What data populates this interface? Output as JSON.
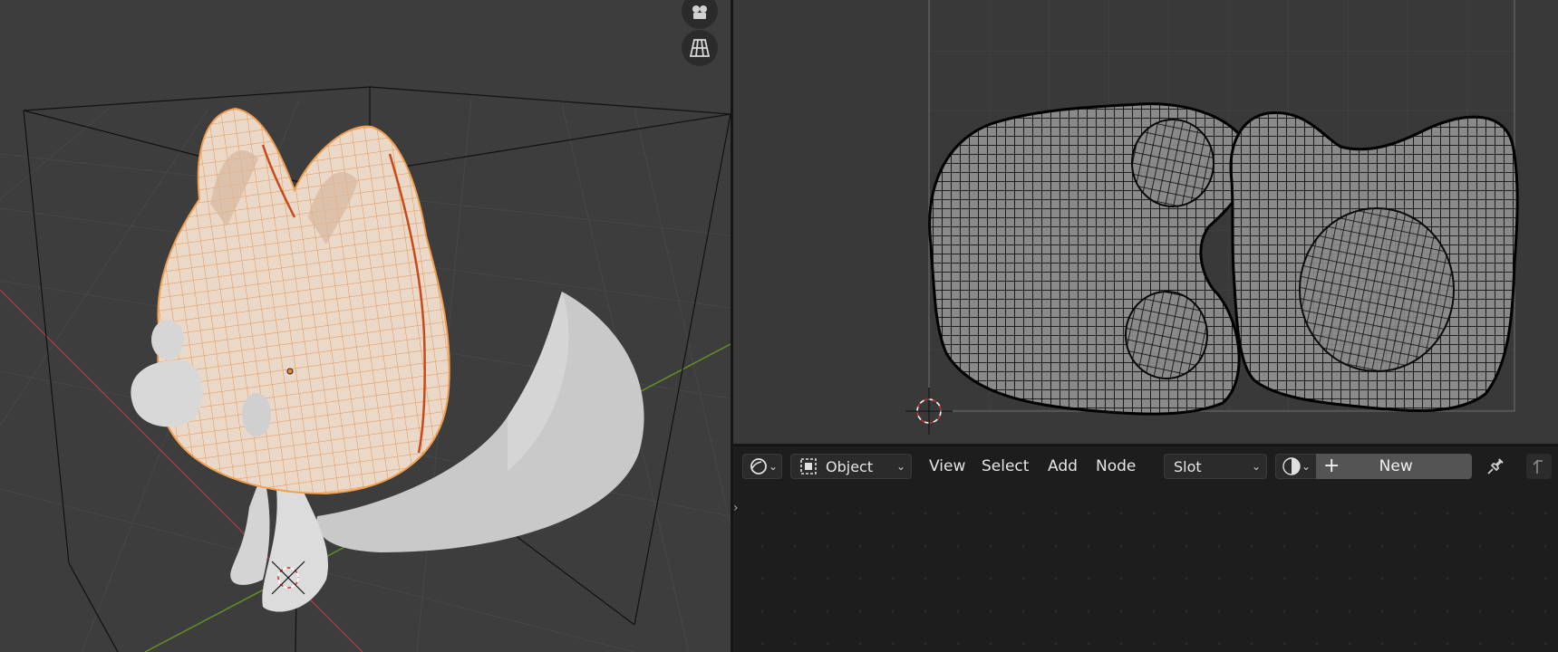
{
  "viewport": {
    "icons": [
      "camera-icon",
      "grid-view-icon"
    ]
  },
  "uv_editor": {
    "icons": [
      "cursor-crosshair-icon"
    ]
  },
  "node_editor": {
    "header": {
      "editor_type_icon": "node-editor-icon",
      "mode_icon": "object-square-icon",
      "mode_label": "Object",
      "menus": [
        "View",
        "Select",
        "Add",
        "Node"
      ],
      "slot_label": "Slot",
      "material_icon": "material-sphere-icon",
      "new_icon": "plus-icon",
      "new_label": "New",
      "pin_icon": "pin-icon",
      "parent_icon": "parent-arrow-icon"
    },
    "sidebar_toggle": "›"
  },
  "colors": {
    "viewport_bg": "#3d3d3d",
    "selection_orange": "#e8893a",
    "x_axis": "#b3414a",
    "y_axis": "#6b9e2c",
    "uv_bg": "#393939"
  }
}
